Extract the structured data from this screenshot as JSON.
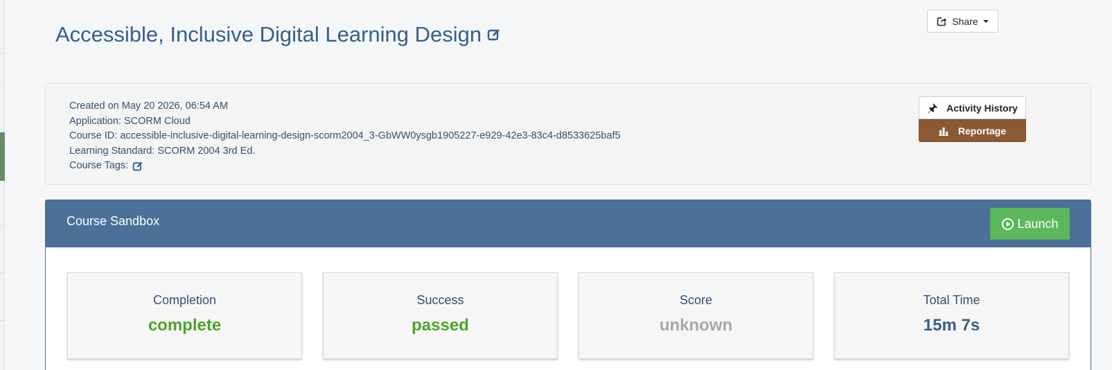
{
  "header": {
    "title": "Accessible, Inclusive Digital Learning Design",
    "share_label": "Share"
  },
  "course_info": {
    "created": "Created on May 20 2026, 06:54 AM",
    "application": "Application: SCORM Cloud",
    "course_id": "Course ID: accessible-inclusive-digital-learning-design-scorm2004_3-GbWW0ysgb1905227-e929-42e3-83c4-d8533625baf5",
    "learning_standard": "Learning Standard: SCORM 2004 3rd Ed.",
    "course_tags_label": "Course Tags:"
  },
  "actions": {
    "activity_history": "Activity History",
    "reportage": "Reportage"
  },
  "sandbox": {
    "title": "Course Sandbox",
    "launch_label": "Launch",
    "stats": [
      {
        "label": "Completion",
        "value": "complete",
        "color": "#4ca428"
      },
      {
        "label": "Success",
        "value": "passed",
        "color": "#4ca428"
      },
      {
        "label": "Score",
        "value": "unknown",
        "color": "#a7a7a7"
      },
      {
        "label": "Total Time",
        "value": "15m 7s",
        "color": "#35608a"
      }
    ]
  },
  "colors": {
    "accent": "#4c7199",
    "reportage": "#8b5a35",
    "launch": "#5cb85c"
  }
}
